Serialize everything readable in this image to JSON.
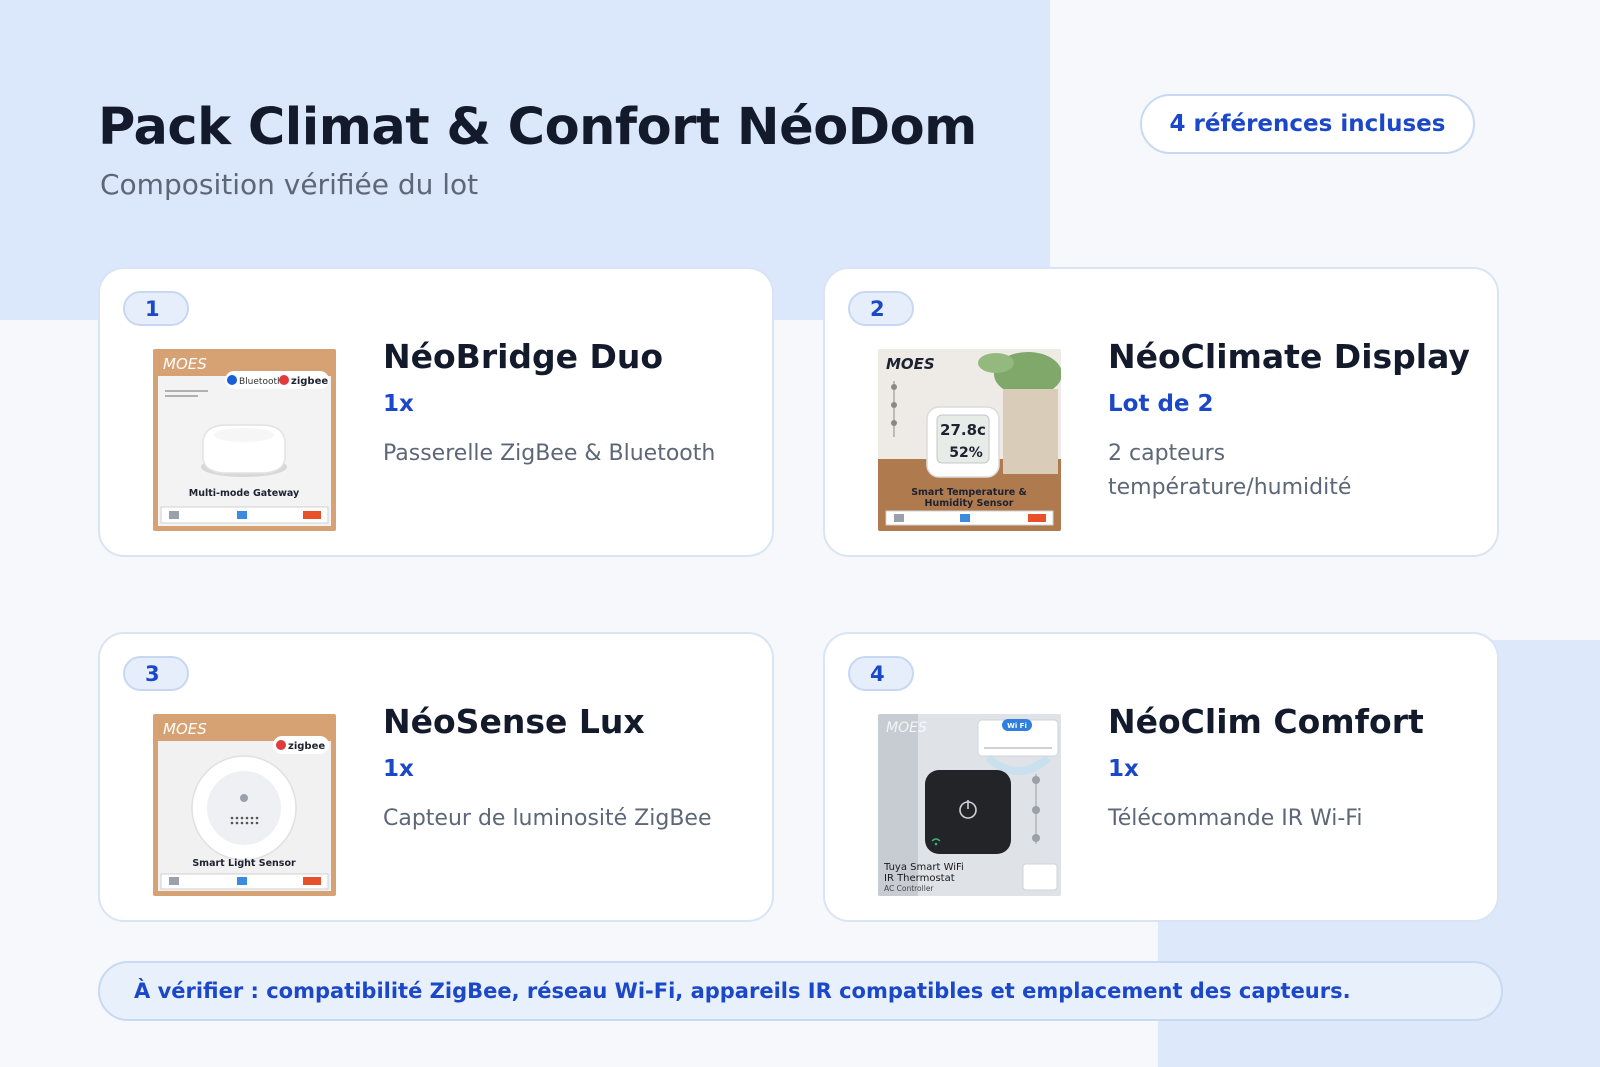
{
  "header": {
    "title": "Pack Climat & Confort NéoDom",
    "subtitle": "Composition vérifiée du lot",
    "count_label": "4 références incluses"
  },
  "products": [
    {
      "index": "1",
      "name": "NéoBridge Duo",
      "quantity": "1x",
      "description": "Passerelle ZigBee & Bluetooth",
      "image": {
        "brand": "MOES",
        "badge_1": "Bluetooth",
        "badge_2": "zigbee",
        "caption": "Multi-mode Gateway"
      }
    },
    {
      "index": "2",
      "name": "NéoClimate Display",
      "quantity": "Lot de 2",
      "description": "2 capteurs température/humidité",
      "image": {
        "brand": "MOES",
        "reading_temp": "27.8c",
        "reading_hum": "52%",
        "caption_1": "Smart Temperature &",
        "caption_2": "Humidity Sensor"
      }
    },
    {
      "index": "3",
      "name": "NéoSense Lux",
      "quantity": "1x",
      "description": "Capteur de luminosité ZigBee",
      "image": {
        "brand": "MOES",
        "badge_1": "zigbee",
        "caption": "Smart Light Sensor"
      }
    },
    {
      "index": "4",
      "name": "NéoClim Comfort",
      "quantity": "1x",
      "description": "Télécommande IR Wi-Fi",
      "image": {
        "brand": "MOES",
        "badge_1": "Wi Fi",
        "caption_1": "Tuya Smart WiFi",
        "caption_2": "IR Thermostat",
        "caption_3": "AC Controller"
      }
    }
  ],
  "footer": {
    "note": "À vérifier : compatibilité ZigBee, réseau Wi-Fi, appareils IR compatibles et emplacement des capteurs."
  },
  "colors": {
    "accent": "#1b47c9",
    "title": "#131a2b",
    "muted": "#5d6778",
    "card_border": "#d9e4f4",
    "background_panel": "#dbe8fb"
  },
  "icons": [
    "power-icon",
    "wifi-icon"
  ]
}
